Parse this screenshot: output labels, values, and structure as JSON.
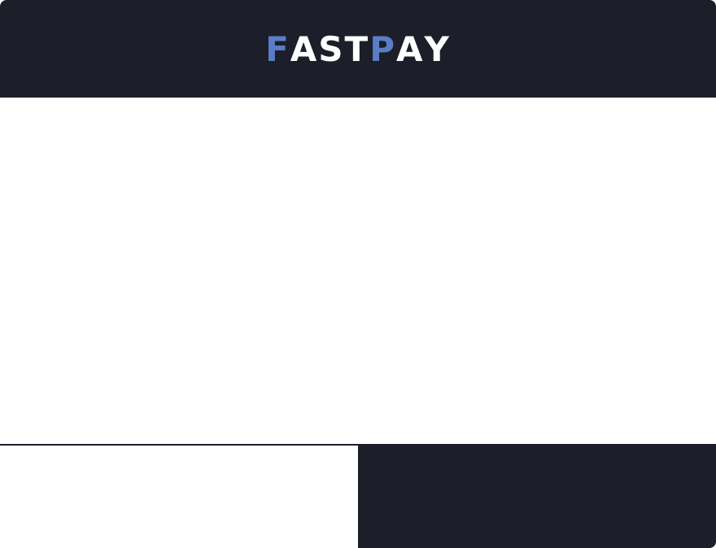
{
  "header": {
    "logo": {
      "letters": [
        {
          "char": "F",
          "color": "#5a7ec6"
        },
        {
          "char": "A",
          "color": "#ffffff"
        },
        {
          "char": "S",
          "color": "#ffffff"
        },
        {
          "char": "T",
          "color": "#ffffff"
        },
        {
          "char": "P",
          "color": "#5a7ec6"
        },
        {
          "char": "A",
          "color": "#ffffff"
        },
        {
          "char": "Y",
          "color": "#ffffff"
        }
      ]
    }
  },
  "colors": {
    "dark": "#1c1e29",
    "accent": "#5a7ec6",
    "light": "#ffffff"
  }
}
